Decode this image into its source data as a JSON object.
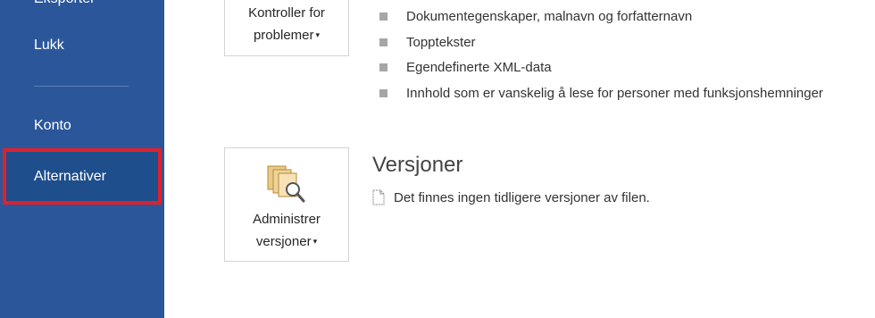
{
  "sidebar": {
    "clipped_item": "Eksporter",
    "close_label": "Lukk",
    "account_label": "Konto",
    "options_label": "Alternativer"
  },
  "inspect": {
    "button_line1": "Kontroller for",
    "button_line2": "problemer",
    "bullets": [
      "Dokumentegenskaper, malnavn og forfatternavn",
      "Topptekster",
      "Egendefinerte XML-data",
      "Innhold som er vanskelig å lese for personer med funksjonshemninger"
    ]
  },
  "versions": {
    "title": "Versjoner",
    "button_line1": "Administrer",
    "button_line2": "versjoner",
    "info_text": "Det finnes ingen tidligere versjoner av filen."
  },
  "icons": {
    "caret": "▾",
    "versions_icon": "versions-magnifier-icon",
    "doc_icon": "document-icon"
  },
  "colors": {
    "sidebar_bg": "#2b579a",
    "selected_bg": "#1f4e8c",
    "highlight_border": "#e0202b",
    "icon_gold": "#d9a441"
  }
}
